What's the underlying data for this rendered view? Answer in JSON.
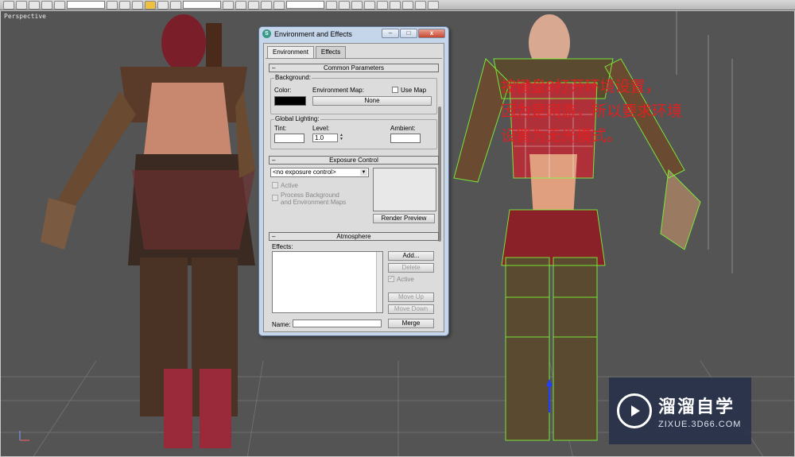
{
  "viewport": {
    "label": "Perspective"
  },
  "annotation": {
    "lines": [
      "按键盘8打开环境设置，",
      "因为是网游，所以要求环境",
      "设置为无光模式。"
    ]
  },
  "watermark": {
    "title": "溜溜自学",
    "subtitle": "ZIXUE.3D66.COM"
  },
  "dialog": {
    "title": "Environment and Effects",
    "app_icon": "S",
    "window_buttons": {
      "minimize": "–",
      "maximize": "□",
      "close": "x"
    },
    "tabs": [
      "Environment",
      "Effects"
    ],
    "common": {
      "header": "Common Parameters",
      "background_group": "Background:",
      "color_label": "Color:",
      "color_value": "#000000",
      "env_map_label": "Environment Map:",
      "use_map_label": "Use Map",
      "env_map_button": "None",
      "global_lighting_group": "Global Lighting:",
      "tint_label": "Tint:",
      "level_label": "Level:",
      "level_value": "1.0",
      "ambient_label": "Ambient:",
      "tint_color": "#ffffff",
      "ambient_color": "#ffffff"
    },
    "exposure": {
      "header": "Exposure Control",
      "selected": "<no exposure control>",
      "active_label": "Active",
      "process_bg_line1": "Process Background",
      "process_bg_line2": "and Environment Maps",
      "render_preview": "Render Preview"
    },
    "atmosphere": {
      "header": "Atmosphere",
      "effects_label": "Effects:",
      "add": "Add...",
      "delete": "Delete",
      "active_label": "Active",
      "move_up": "Move Up",
      "move_down": "Move Down",
      "name_label": "Name:",
      "merge": "Merge"
    },
    "rollout_minus": "–"
  },
  "colors": {
    "annotation": "#e02020",
    "wireframe_select": "#7cff3a",
    "watermark_bg": "#28324b"
  }
}
